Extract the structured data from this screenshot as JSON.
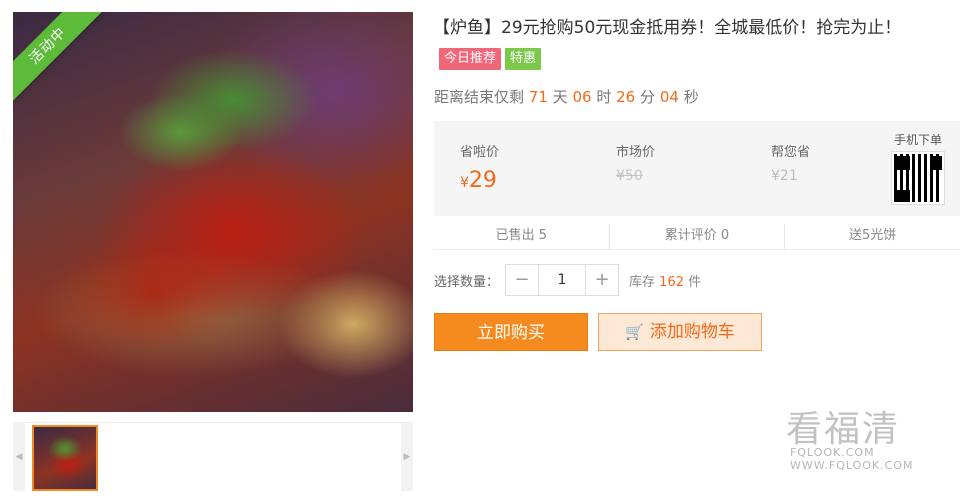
{
  "gallery": {
    "activity_label": "活动中",
    "prev_arrow": "◀",
    "next_arrow": "▶"
  },
  "product": {
    "title": "【炉鱼】29元抢购50元现金抵用券！全城最低价！抢完为止！",
    "tags": [
      "今日推荐",
      "特惠"
    ]
  },
  "countdown": {
    "prefix": "距离结束仅剩",
    "days": "71",
    "days_unit": "天",
    "hours": "06",
    "hours_unit": "时",
    "minutes": "26",
    "minutes_unit": "分",
    "seconds": "04",
    "seconds_unit": "秒"
  },
  "pricing": {
    "save_label": "省啦价",
    "save_currency": "¥",
    "save_price": "29",
    "market_label": "市场价",
    "market_price": "¥50",
    "help_label": "帮您省",
    "help_price": "¥21",
    "mobile_label": "手机下单"
  },
  "stats": {
    "sold": "已售出 5",
    "reviews": "累计评价 0",
    "gift": "送5光饼"
  },
  "quantity": {
    "label": "选择数量：",
    "minus": "−",
    "value": "1",
    "plus": "+",
    "stock_prefix": "库存",
    "stock_count": "162",
    "stock_unit": "件"
  },
  "actions": {
    "buy": "立即购买",
    "cart_icon": "🛒",
    "cart": "添加购物车"
  },
  "watermark": {
    "main": "看福清",
    "sub": "FQLOOK.COM  WWW.FQLOOK.COM"
  },
  "colors": {
    "accent_orange": "#f58a1e",
    "price_orange": "#f06a1a",
    "tag_red": "#f0677a",
    "tag_green": "#7cc84b",
    "ribbon_green": "#5dbb3a"
  }
}
